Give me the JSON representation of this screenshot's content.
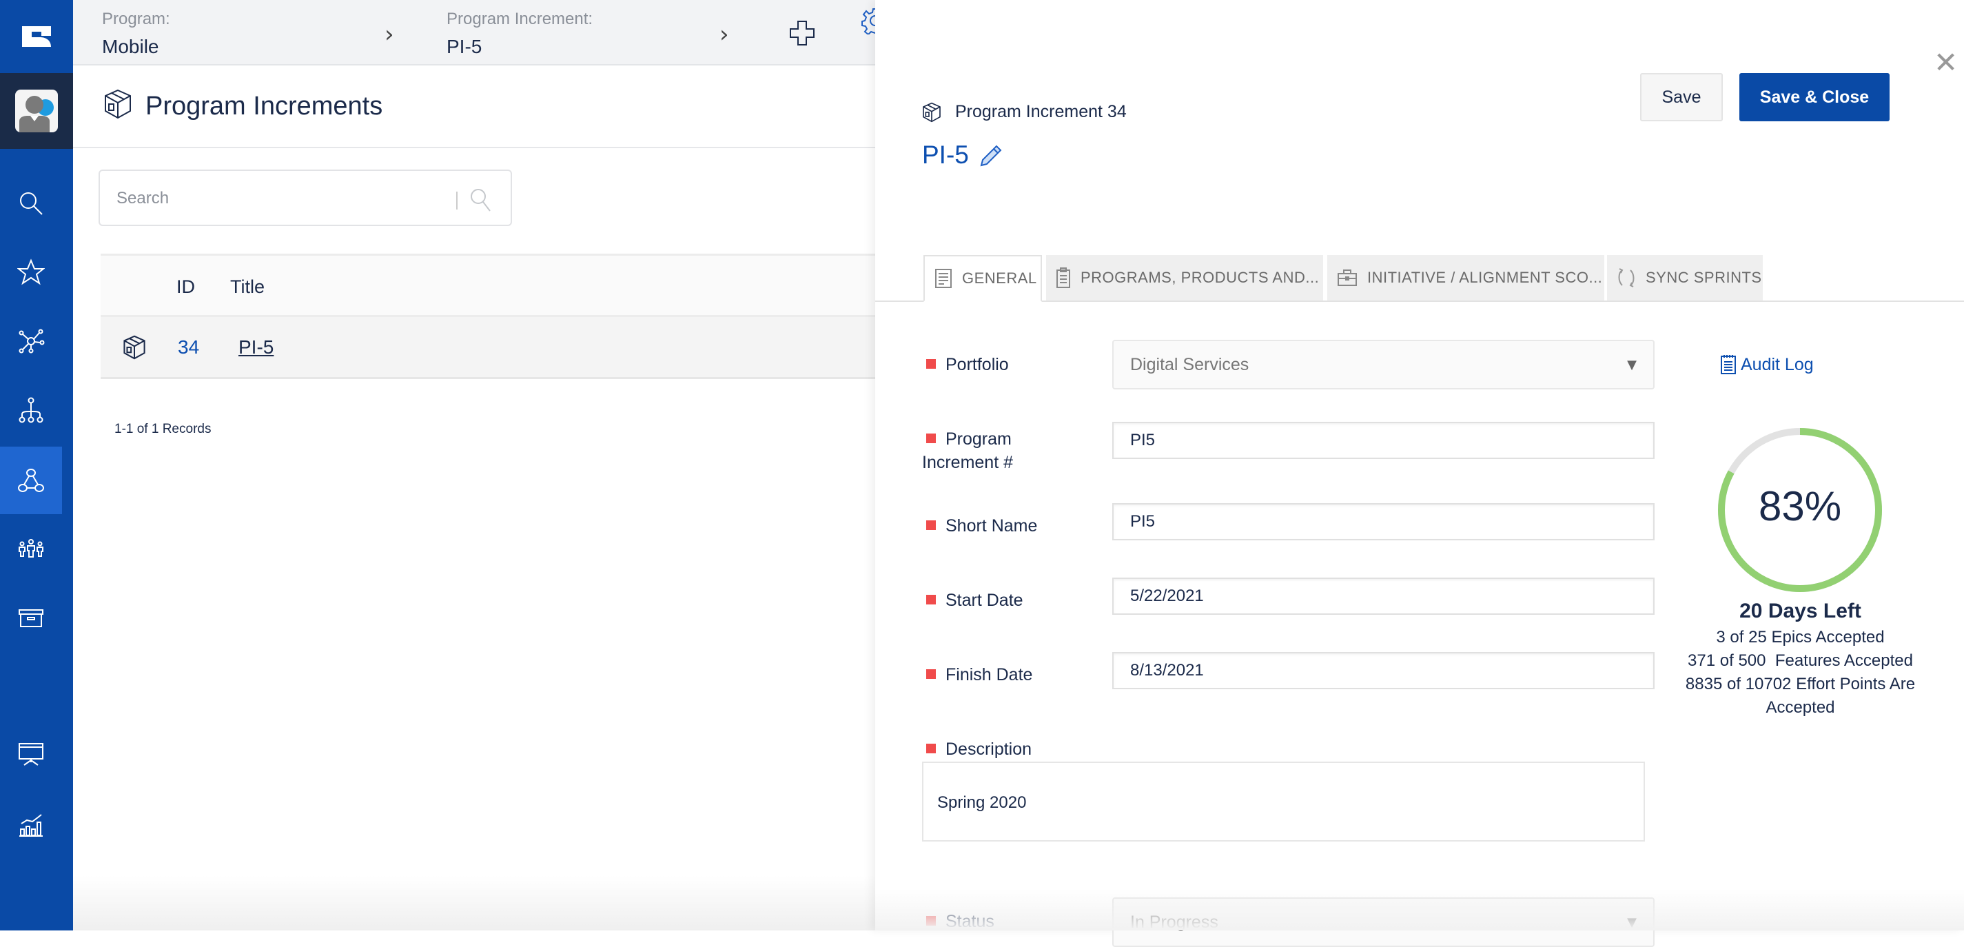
{
  "sidebar": {
    "logo": "app-logo",
    "items": [
      {
        "name": "search",
        "icon": "search-icon"
      },
      {
        "name": "favorites",
        "icon": "star-icon"
      },
      {
        "name": "network",
        "icon": "network-icon"
      },
      {
        "name": "hierarchy",
        "icon": "hierarchy-icon"
      },
      {
        "name": "programs",
        "icon": "triangle-nodes-icon",
        "active": true
      },
      {
        "name": "teams",
        "icon": "people-icon"
      },
      {
        "name": "archive",
        "icon": "archive-box-icon"
      },
      {
        "name": "presentation",
        "icon": "presentation-icon"
      },
      {
        "name": "reports",
        "icon": "chart-icon"
      }
    ]
  },
  "topbar": {
    "breadcrumbs": [
      {
        "label": "Program:",
        "value": "Mobile"
      },
      {
        "label": "Program Increment:",
        "value": "PI-5"
      }
    ]
  },
  "page": {
    "title": "Program Increments",
    "search_placeholder": "Search",
    "grid": {
      "columns": [
        "ID",
        "Title"
      ],
      "rows": [
        {
          "id": "34",
          "title": "PI-5"
        }
      ]
    },
    "records": "1-1 of 1 Records"
  },
  "panel": {
    "subtitle": "Program Increment 34",
    "title": "PI-5",
    "save_label": "Save",
    "save_close_label": "Save & Close",
    "close_label": "✕",
    "tabs": [
      {
        "label": "GENERAL",
        "active": true
      },
      {
        "label": "PROGRAMS, PRODUCTS AND..."
      },
      {
        "label": "INITIATIVE / ALIGNMENT SCO..."
      },
      {
        "label": "SYNC SPRINTS"
      }
    ],
    "fields": {
      "portfolio": {
        "label": "Portfolio",
        "value": "Digital Services"
      },
      "pi_number": {
        "label_line1": "Program",
        "label_line2": "Increment #",
        "value": "PI5"
      },
      "short_name": {
        "label": "Short Name",
        "value": "PI5"
      },
      "start_date": {
        "label": "Start Date",
        "value": "5/22/2021"
      },
      "finish_date": {
        "label": "Finish Date",
        "value": "8/13/2021"
      },
      "description": {
        "label": "Description",
        "value": "Spring 2020"
      },
      "status": {
        "label": "Status",
        "value": "In Progress"
      }
    },
    "audit_log": "Audit Log",
    "progress": {
      "percent": 83,
      "percent_label": "83%",
      "days_left": "20 Days Left",
      "epics": "3 of 25 Epics Accepted",
      "features": "371 of 500  Features Accepted",
      "effort_line1": "8835 of 10702 Effort Points Are",
      "effort_line2": "Accepted",
      "color_done": "#92d072",
      "color_remaining": "#e2e2e2"
    }
  }
}
